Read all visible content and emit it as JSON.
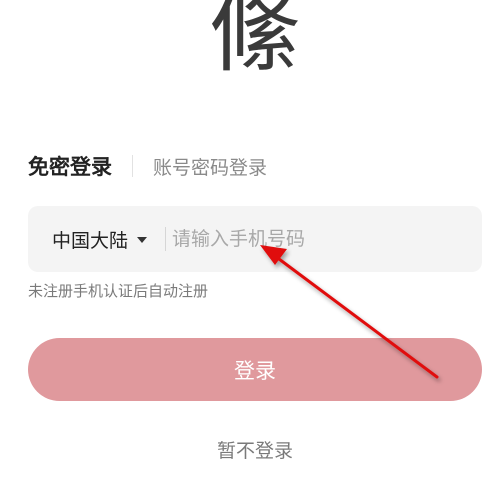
{
  "logo": {
    "glyph": "絛"
  },
  "tabs": {
    "active_label": "免密登录",
    "inactive_label": "账号密码登录"
  },
  "phone": {
    "region_label": "中国大陆",
    "input_value": "",
    "input_placeholder": "请输入手机号码"
  },
  "hint": {
    "text": "未注册手机认证后自动注册"
  },
  "login_button": {
    "label": "登录"
  },
  "skip": {
    "label": "暂不登录"
  },
  "colors": {
    "login_button_bg": "#e0999d",
    "annotation_arrow": "#e01010",
    "input_bg": "#f4f4f4"
  }
}
